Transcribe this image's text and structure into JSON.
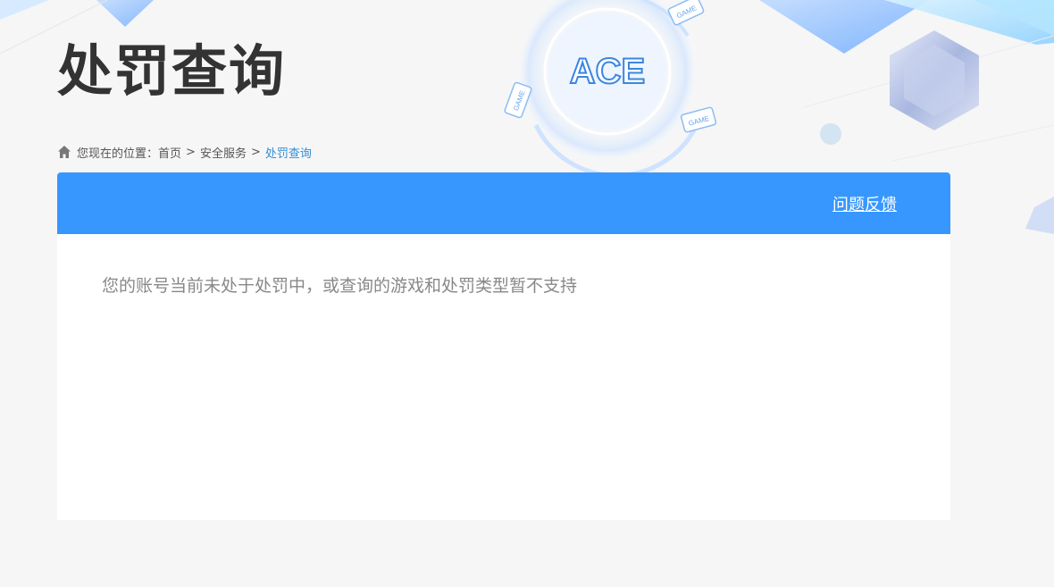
{
  "page": {
    "title": "处罚查询"
  },
  "breadcrumb": {
    "prefix": "您现在的位置：",
    "items": [
      {
        "label": "首页"
      },
      {
        "label": "安全服务"
      }
    ],
    "separator": ">",
    "current": "处罚查询"
  },
  "panel": {
    "feedback_label": "问题反馈",
    "message": "您的账号当前未处于处罚中，或查询的游戏和处罚类型暂不支持"
  },
  "decor": {
    "logo_text": "ACE",
    "badge_text": "GAME"
  },
  "colors": {
    "accent": "#3797ff",
    "link": "#2f8fd6",
    "title": "#333333",
    "background": "#f6f6f6"
  }
}
